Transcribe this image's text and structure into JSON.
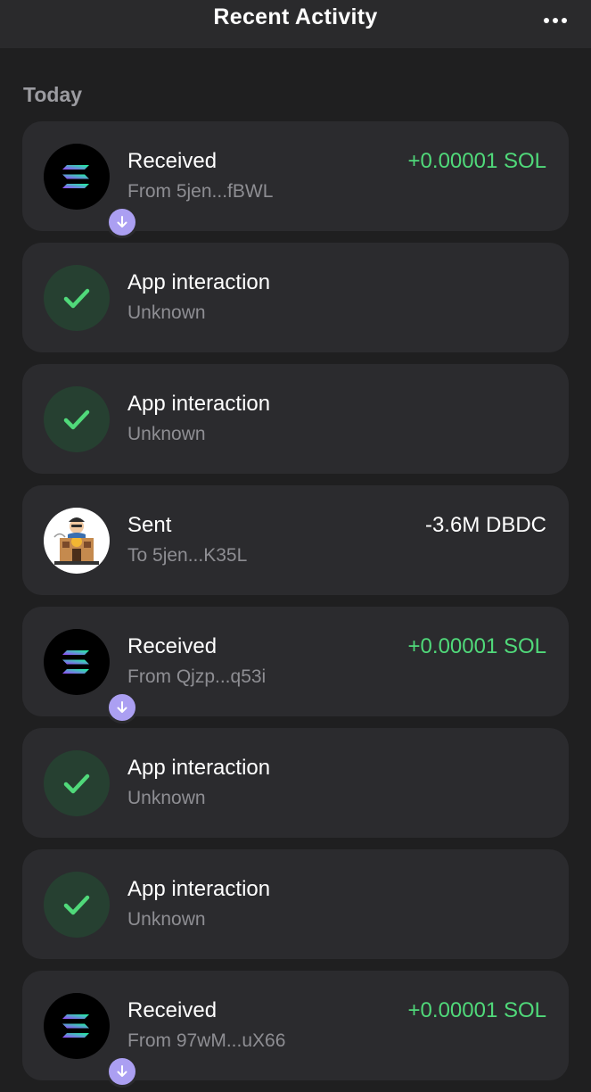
{
  "header": {
    "title": "Recent Activity",
    "more_icon": "more-horizontal-icon"
  },
  "section": {
    "title": "Today"
  },
  "colors": {
    "background": "#1f1f20",
    "card": "#2b2b2e",
    "positive_amount": "#50d97a",
    "received_badge": "#ab9ff2",
    "sent_badge": "#4a9df2",
    "check_circle": "#264031",
    "check_mark": "#50d97a"
  },
  "activity": [
    {
      "type": "received",
      "icon": "solana-icon",
      "badge": "arrow-down-icon",
      "title": "Received",
      "subtitle": "From 5jen...fBWL",
      "amount": "+0.00001 SOL"
    },
    {
      "type": "app_interaction",
      "icon": "checkmark-icon",
      "title": "App interaction",
      "subtitle": "Unknown",
      "amount": ""
    },
    {
      "type": "app_interaction",
      "icon": "checkmark-icon",
      "title": "App interaction",
      "subtitle": "Unknown",
      "amount": ""
    },
    {
      "type": "sent",
      "icon": "dbdc-token-icon",
      "badge": "paper-plane-icon",
      "title": "Sent",
      "subtitle": "To 5jen...K35L",
      "amount": "-3.6M DBDC"
    },
    {
      "type": "received",
      "icon": "solana-icon",
      "badge": "arrow-down-icon",
      "title": "Received",
      "subtitle": "From Qjzp...q53i",
      "amount": "+0.00001 SOL"
    },
    {
      "type": "app_interaction",
      "icon": "checkmark-icon",
      "title": "App interaction",
      "subtitle": "Unknown",
      "amount": ""
    },
    {
      "type": "app_interaction",
      "icon": "checkmark-icon",
      "title": "App interaction",
      "subtitle": "Unknown",
      "amount": ""
    },
    {
      "type": "received",
      "icon": "solana-icon",
      "badge": "arrow-down-icon",
      "title": "Received",
      "subtitle": "From 97wM...uX66",
      "amount": "+0.00001 SOL"
    }
  ]
}
